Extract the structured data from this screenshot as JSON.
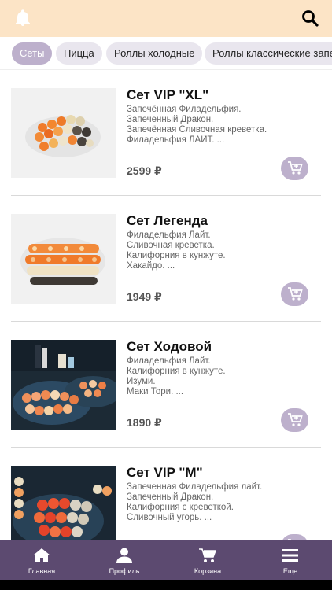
{
  "header": {
    "notification_icon": "bell-icon",
    "search_icon": "search-icon"
  },
  "categories": [
    {
      "label": "Сеты",
      "active": true
    },
    {
      "label": "Пицца",
      "active": false
    },
    {
      "label": "Роллы холодные",
      "active": false
    },
    {
      "label": "Роллы классические запе",
      "active": false
    }
  ],
  "products": [
    {
      "title": "Сет VIP \"XL\"",
      "description": [
        "Запечённая Филадельфия.",
        "Запеченный Дракон.",
        "Запечённая Сливочная креветка.",
        "Филадельфия ЛАЙТ.  ..."
      ],
      "price": "2599 ₽"
    },
    {
      "title": "Сет Легенда",
      "description": [
        "Филадельфия Лайт.",
        "Сливочная креветка.",
        "Калифорния в кунжуте.",
        "Хакайдо. ..."
      ],
      "price": "1949 ₽"
    },
    {
      "title": "Сет Ходовой",
      "description": [
        "Филадельфия Лайт.",
        "Калифорния в кунжуте.",
        "Изуми.",
        "Маки Тори.  ..."
      ],
      "price": "1890 ₽"
    },
    {
      "title": "Сет VIP \"M\"",
      "description": [
        "Запеченная Филадельфия лайт.",
        "Запеченный Дракон.",
        "Калифорния с креветкой.",
        "Сливочный угорь.  ..."
      ],
      "price": ""
    }
  ],
  "bottom_nav": [
    {
      "label": "Главная",
      "icon": "home-icon"
    },
    {
      "label": "Профиль",
      "icon": "user-icon"
    },
    {
      "label": "Корзина",
      "icon": "cart-icon"
    },
    {
      "label": "Еще",
      "icon": "menu-icon"
    }
  ],
  "colors": {
    "header_bg": "#fce4c6",
    "accent": "#bdb0cc",
    "nav_bg": "#5c4a70"
  }
}
